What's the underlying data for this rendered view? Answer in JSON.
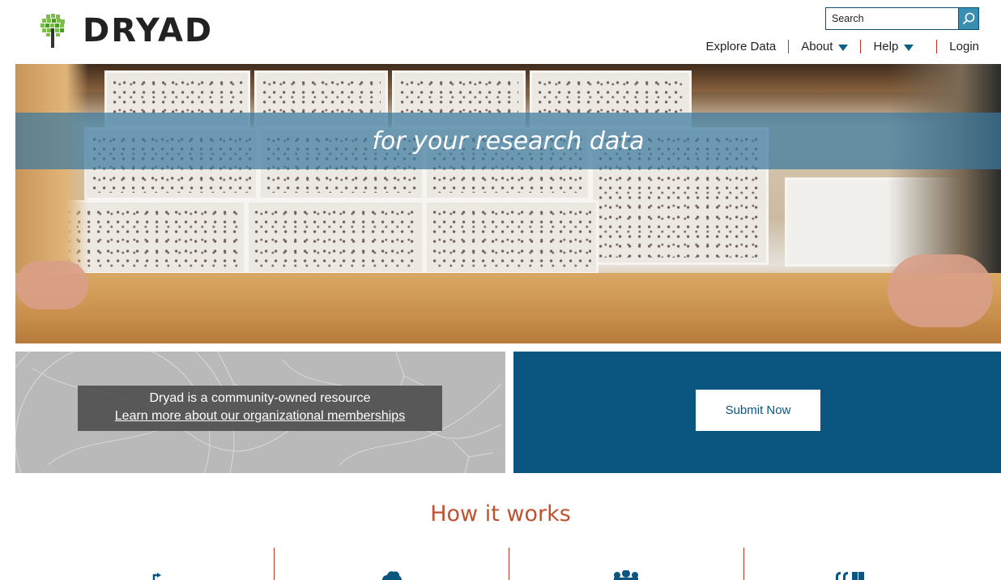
{
  "brand": {
    "name": "DRYAD",
    "colors": {
      "accent": "#0b5680",
      "heading": "#c0532f",
      "divider": "#c0392b"
    }
  },
  "search": {
    "placeholder": "Search"
  },
  "nav": {
    "explore": "Explore Data",
    "about": "About",
    "help": "Help",
    "login": "Login"
  },
  "hero": {
    "tagline": "for your research data"
  },
  "membership": {
    "line1": "Dryad is a community-owned resource",
    "link": "Learn more about our organizational memberships"
  },
  "submit": {
    "label": "Submit Now"
  },
  "how_it_works": {
    "title": "How it works",
    "icons": [
      "upload-icon",
      "cloud-icon",
      "community-icon",
      "cite-icon"
    ]
  }
}
